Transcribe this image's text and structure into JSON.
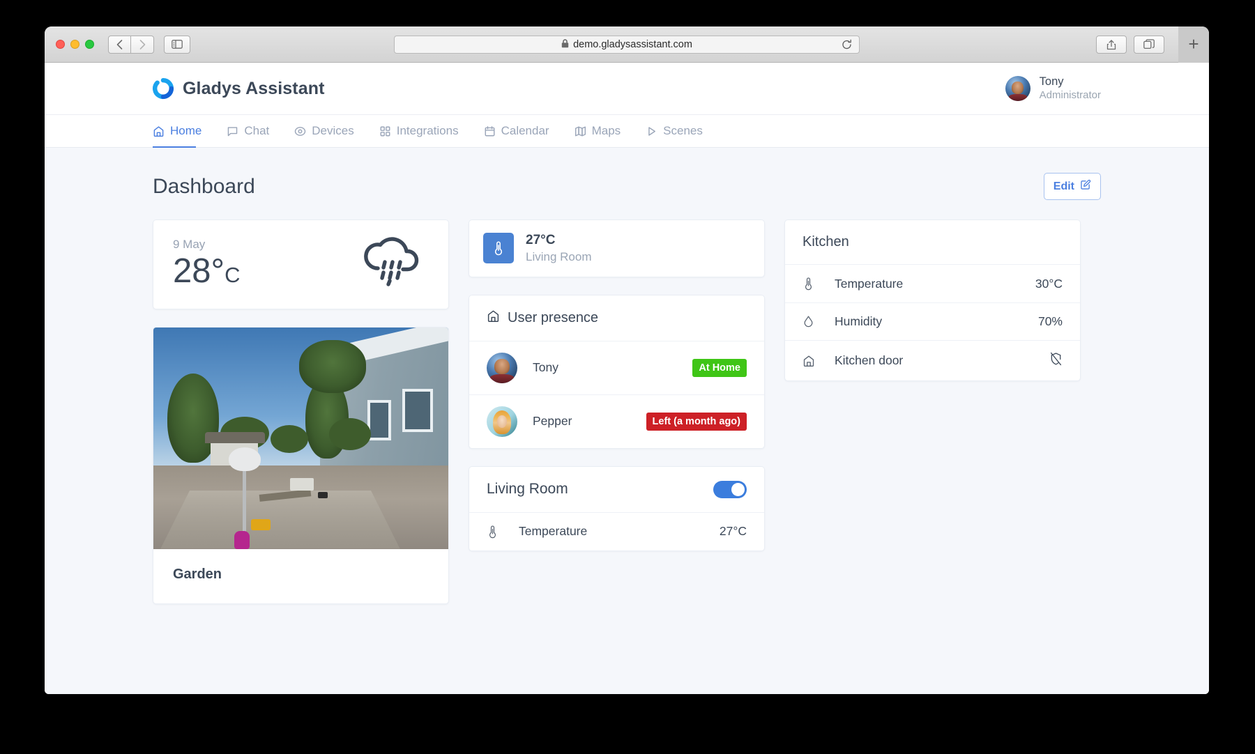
{
  "browser": {
    "url": "demo.gladysassistant.com",
    "lock_icon": "lock-icon",
    "back_icon": "chevron-left-icon",
    "forward_icon": "chevron-right-icon",
    "sidebar_icon": "sidebar-icon",
    "reload_icon": "reload-icon",
    "share_icon": "share-icon",
    "tabs_icon": "tab-overview-icon",
    "new_tab_label": "+"
  },
  "header": {
    "brand": "Gladys Assistant",
    "logo_icon": "gladys-logo-icon",
    "user": {
      "name": "Tony",
      "role": "Administrator",
      "avatar_icon": "user-avatar"
    }
  },
  "nav": {
    "items": [
      {
        "label": "Home",
        "icon": "home-icon",
        "active": true
      },
      {
        "label": "Chat",
        "icon": "chat-icon",
        "active": false
      },
      {
        "label": "Devices",
        "icon": "device-icon",
        "active": false
      },
      {
        "label": "Integrations",
        "icon": "grid-icon",
        "active": false
      },
      {
        "label": "Calendar",
        "icon": "calendar-icon",
        "active": false
      },
      {
        "label": "Maps",
        "icon": "map-icon",
        "active": false
      },
      {
        "label": "Scenes",
        "icon": "play-icon",
        "active": false
      }
    ]
  },
  "page": {
    "title": "Dashboard",
    "edit_button": {
      "label": "Edit",
      "icon": "edit-pencil-icon"
    }
  },
  "cards": {
    "weather": {
      "date": "9 May",
      "temperature": "28°",
      "unit": "C",
      "icon": "rain-cloud-icon"
    },
    "camera": {
      "title": "Garden",
      "image_icon": "camera-snapshot"
    },
    "device_tile": {
      "value": "27°C",
      "room": "Living Room",
      "icon": "thermometer-icon",
      "icon_bg": "#4a82d2"
    },
    "user_presence": {
      "title": "User presence",
      "icon": "home-icon",
      "users": [
        {
          "name": "Tony",
          "status": "At Home",
          "status_color": "#3fc516",
          "avatar_icon": "tony-avatar"
        },
        {
          "name": "Pepper",
          "status": "Left (a month ago)",
          "status_color": "#cd2026",
          "avatar_icon": "pepper-avatar"
        }
      ]
    },
    "living_room": {
      "title": "Living Room",
      "toggle_on": true,
      "toggle_color": "#3b7ddd",
      "devices": [
        {
          "name": "Temperature",
          "value": "27°C",
          "icon": "thermometer-icon"
        }
      ]
    },
    "kitchen": {
      "title": "Kitchen",
      "devices": [
        {
          "name": "Temperature",
          "value": "30°C",
          "icon": "thermometer-icon",
          "value_icon": null
        },
        {
          "name": "Humidity",
          "value": "70%",
          "icon": "droplet-icon",
          "value_icon": null
        },
        {
          "name": "Kitchen door",
          "value": "",
          "icon": "house-icon",
          "value_icon": "shield-off-icon"
        }
      ]
    }
  },
  "colors": {
    "accent": "#4b7fe0",
    "text": "#3c4858",
    "muted": "#9aa5b5",
    "page_bg": "#f5f7fb"
  }
}
